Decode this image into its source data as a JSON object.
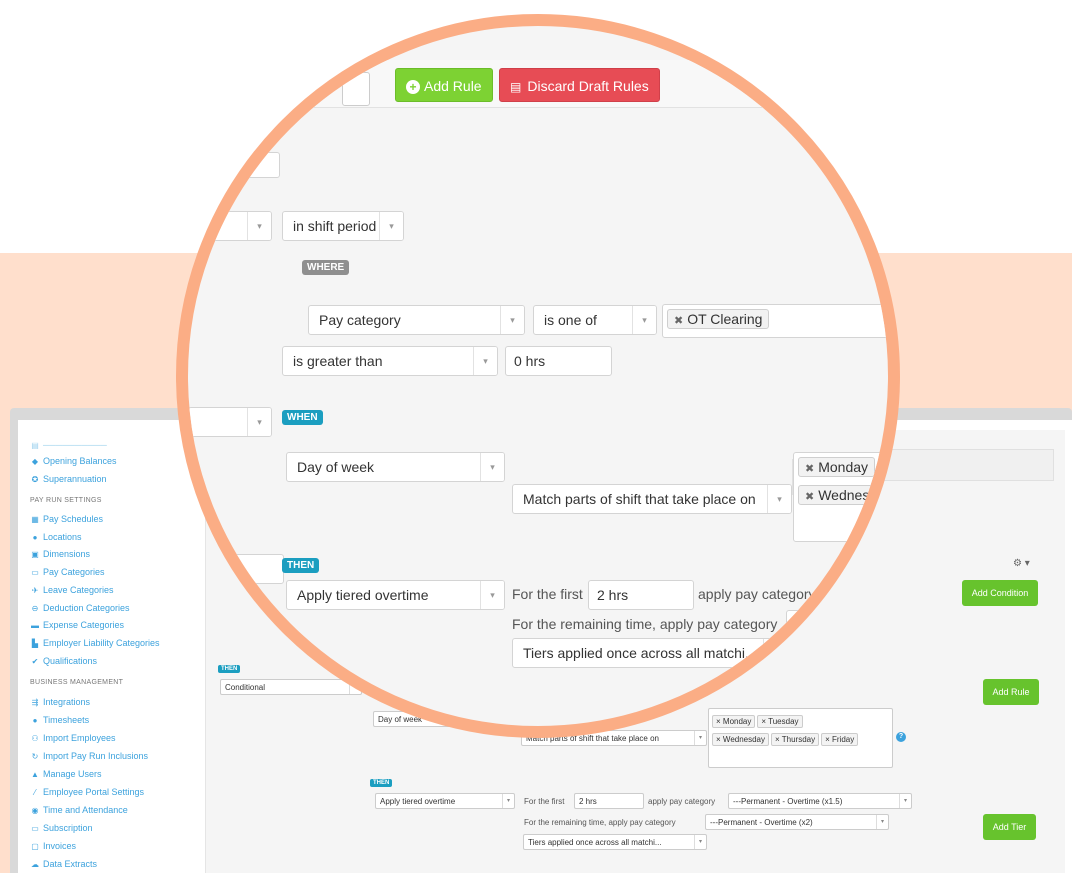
{
  "toolbar": {
    "add_rule": "Add Rule",
    "discard": "Discard Draft Rules"
  },
  "zoomed": {
    "shift_period": "in shift period",
    "where_badge": "WHERE",
    "pay_category_field": "Pay category",
    "is_one_of": "is one of",
    "ot_clearing": "OT Clearing",
    "is_greater_than": "is greater than",
    "zero_hrs": "0 hrs",
    "when_badge": "WHEN",
    "day_of_week": "Day of week",
    "match_parts": "Match parts of shift that take place on",
    "tag_monday": "Monday",
    "tag_wednesday": "Wednesd",
    "then_badge": "THEN",
    "apply_tiered": "Apply tiered overtime",
    "for_first": "For the first",
    "first_hrs": "2 hrs",
    "apply_pay_category": "apply pay category",
    "remaining_time": "For the remaining time, apply pay category",
    "tiers_applied": "Tiers applied once across all matchi..."
  },
  "sidebar": {
    "sections": {
      "pay_run_settings": "PAY RUN SETTINGS",
      "business_management": "BUSINESS MANAGEMENT"
    },
    "items": {
      "opening_balances": "Opening Balances",
      "superannuation": "Superannuation",
      "pay_schedules": "Pay Schedules",
      "locations": "Locations",
      "dimensions": "Dimensions",
      "pay_categories": "Pay Categories",
      "leave_categories": "Leave Categories",
      "deduction_categories": "Deduction Categories",
      "expense_categories": "Expense Categories",
      "employer_liability_categories": "Employer Liability Categories",
      "qualifications": "Qualifications",
      "integrations": "Integrations",
      "timesheets": "Timesheets",
      "import_employees": "Import Employees",
      "import_pay_run_inclusions": "Import Pay Run Inclusions",
      "manage_users": "Manage Users",
      "employee_portal_settings": "Employee Portal Settings",
      "time_and_attendance": "Time and Attendance",
      "subscription": "Subscription",
      "invoices": "Invoices",
      "data_extracts": "Data Extracts"
    }
  },
  "background": {
    "add_condition": "Add Condition",
    "then_badge": "THEN",
    "conditional": "Conditional",
    "add_rule": "Add Rule",
    "day_of_week": "Day of week",
    "match_parts": "Match parts of shift that take place on",
    "days": [
      "Monday",
      "Tuesday",
      "Wednesday",
      "Thursday",
      "Friday"
    ],
    "then_badge_2": "THEN",
    "apply_tiered": "Apply tiered overtime",
    "for_first": "For the first",
    "first_hrs": "2 hrs",
    "apply_pay_category": "apply pay category",
    "perm_ot_15": "---Permanent - Overtime (x1.5)",
    "remaining_time": "For the remaining time, apply pay category",
    "perm_ot_2": "---Permanent - Overtime (x2)",
    "tiers_applied": "Tiers applied once across all matchi...",
    "add_tier": "Add Tier"
  },
  "colors": {
    "peach": "#ffdfcc",
    "ring": "#fbad85",
    "green": "#67c32d",
    "red": "#e74c55",
    "teal_badge": "#1b9ec0",
    "link_blue": "#3ca2dd"
  }
}
